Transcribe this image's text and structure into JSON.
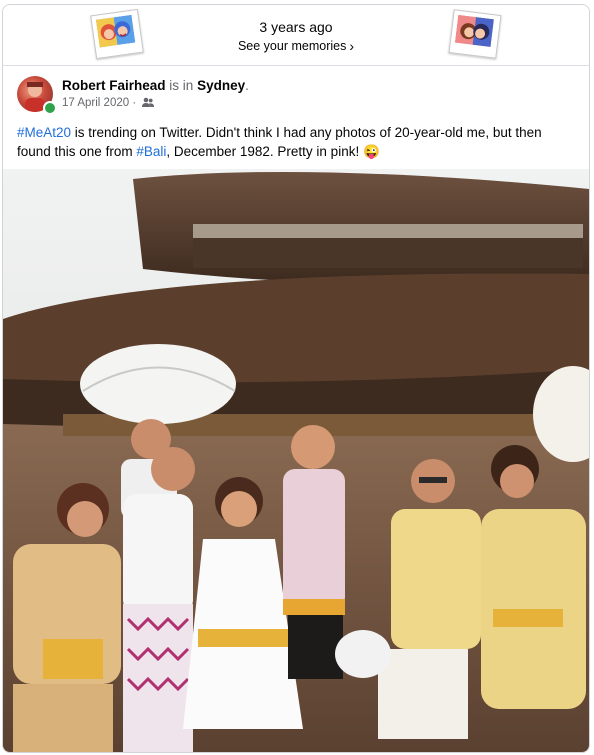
{
  "memories": {
    "years_ago": "3 years ago",
    "see_memories": "See your memories",
    "chevron": "›"
  },
  "post": {
    "author": "Robert Fairhead",
    "is_in": "is in",
    "location": "Sydney",
    "period": ".",
    "date": "17 April 2020",
    "audience_icon": "friends-icon",
    "text": {
      "hashtag1": "#MeAt20",
      "part1": " is trending on Twitter. Didn't think I had any photos of 20-year-old me, but then found this one from ",
      "hashtag2": "#Bali",
      "part2": ", December 1982. Pretty in pink! ",
      "emoji": "😜"
    }
  },
  "colors": {
    "link": "#216fdb",
    "secondary_text": "#65676b",
    "online": "#31a24c",
    "sky": "#e9ecee",
    "thatch": "#5b3f2c"
  }
}
